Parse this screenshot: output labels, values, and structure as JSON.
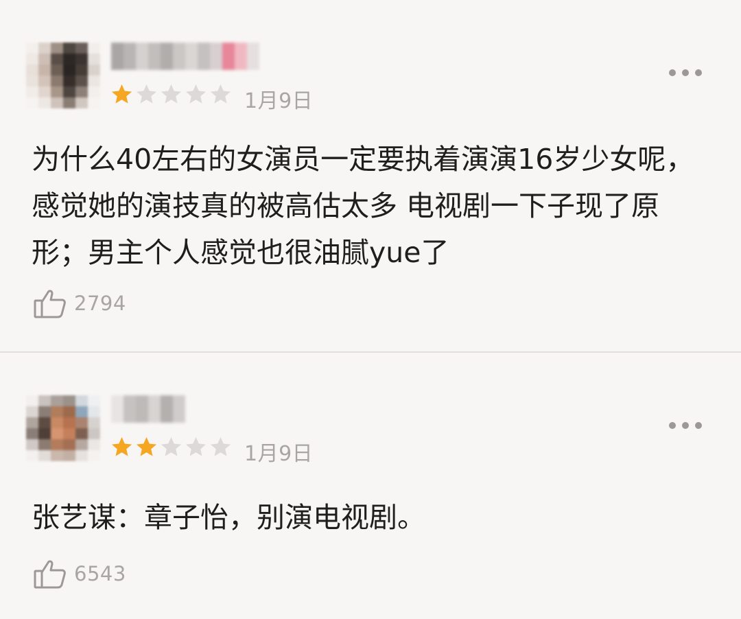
{
  "reviews": [
    {
      "rating": 1,
      "rating_max": 5,
      "date": "1月9日",
      "content": "为什么40左右的女演员一定要执着演演16岁少女呢，感觉她的演技真的被高估太多 电视剧一下子现了原形；男主个人感觉也很油腻yue了",
      "likes": "2794"
    },
    {
      "rating": 2,
      "rating_max": 5,
      "date": "1月9日",
      "content": "张艺谋：章子怡，别演电视剧。",
      "likes": "6543"
    }
  ],
  "icons": {
    "more": "more-icon",
    "like": "thumbs-up-icon",
    "star": "star-icon"
  },
  "colors": {
    "background": "#f8f6f4",
    "star_filled": "#f5a623",
    "star_empty": "#dcd9d6",
    "meta_text": "#a8a5a2",
    "body_text": "#1e1e1e"
  }
}
